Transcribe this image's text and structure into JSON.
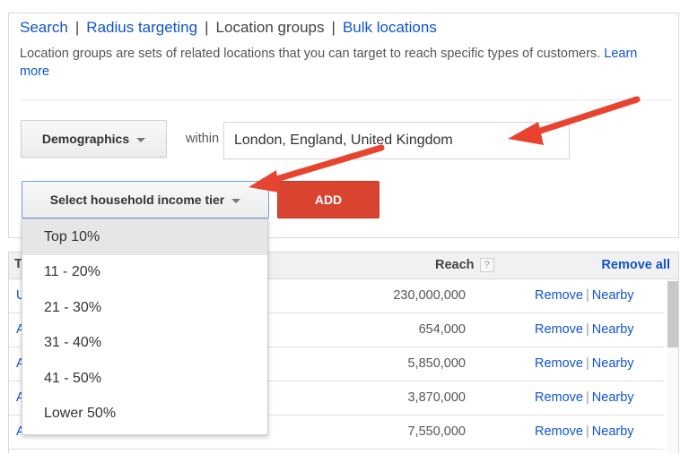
{
  "nav": {
    "tabs": [
      {
        "label": "Search",
        "active": false
      },
      {
        "label": "Radius targeting",
        "active": false
      },
      {
        "label": "Location groups",
        "active": true
      },
      {
        "label": "Bulk locations",
        "active": false
      }
    ],
    "separator": "|"
  },
  "description": {
    "text": "Location groups are sets of related locations that you can target to reach specific types of customers.",
    "learn_more": "Learn more"
  },
  "form": {
    "group_type_select": "Demographics",
    "within_label": "within",
    "location_value": "London, England, United Kingdom",
    "income_select": "Select household income tier",
    "add_button": "ADD"
  },
  "income_menu": {
    "options": [
      "Top 10%",
      "11 - 20%",
      "21 - 30%",
      "31 - 40%",
      "41 - 50%",
      "Lower 50%"
    ],
    "highlighted_index": 0
  },
  "table": {
    "header": {
      "first_col": "T",
      "reach": "Reach",
      "help": "?",
      "remove_all": "Remove all"
    },
    "rows": [
      {
        "name": "U",
        "reach": "230,000,000",
        "remove": "Remove",
        "nearby": "Nearby"
      },
      {
        "name": "A",
        "reach": "654,000",
        "remove": "Remove",
        "nearby": "Nearby"
      },
      {
        "name": "A",
        "reach": "5,850,000",
        "remove": "Remove",
        "nearby": "Nearby"
      },
      {
        "name": "A",
        "reach": "3,870,000",
        "remove": "Remove",
        "nearby": "Nearby"
      },
      {
        "name": "A",
        "reach": "7,550,000",
        "remove": "Remove",
        "nearby": "Nearby"
      }
    ],
    "action_separator": "|"
  },
  "colors": {
    "link": "#1155cc",
    "add_button": "#d84430",
    "annotation_arrow": "#e8432f",
    "focus_border": "#6d9eeb"
  }
}
